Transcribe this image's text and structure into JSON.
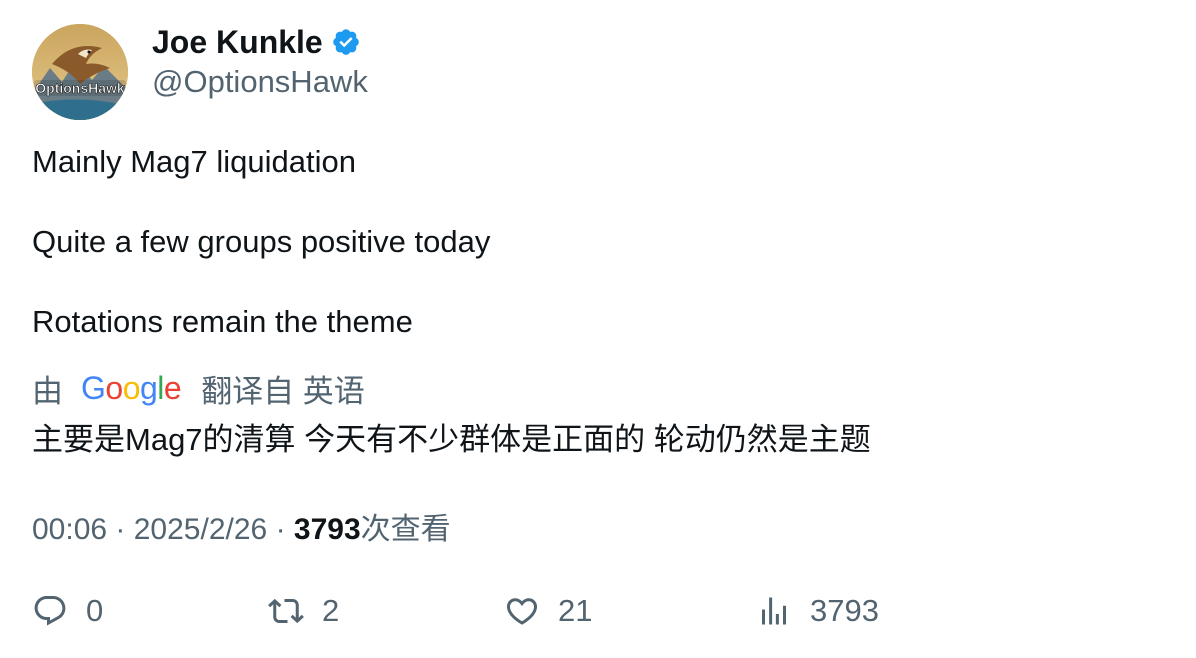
{
  "author": {
    "display_name": "Joe Kunkle",
    "handle": "@OptionsHawk",
    "verified": true,
    "avatar_logo_text": "OptionsHawk"
  },
  "tweet": {
    "lines": [
      "Mainly Mag7 liquidation",
      "Quite a few groups positive today",
      "Rotations remain the theme"
    ]
  },
  "translation": {
    "prefix": "由",
    "provider": "Google",
    "suffix": "翻译自 英语",
    "text": "主要是Mag7的清算 今天有不少群体是正面的 轮动仍然是主题"
  },
  "meta": {
    "time": "00:06",
    "separator": "·",
    "date": "2025/2/26",
    "views_count": "3793",
    "views_label": "次查看"
  },
  "actions": {
    "replies": "0",
    "retweets": "2",
    "likes": "21",
    "views": "3793"
  },
  "colors": {
    "text_primary": "#0f1419",
    "text_secondary": "#536471",
    "verified_blue": "#1d9bf0"
  }
}
